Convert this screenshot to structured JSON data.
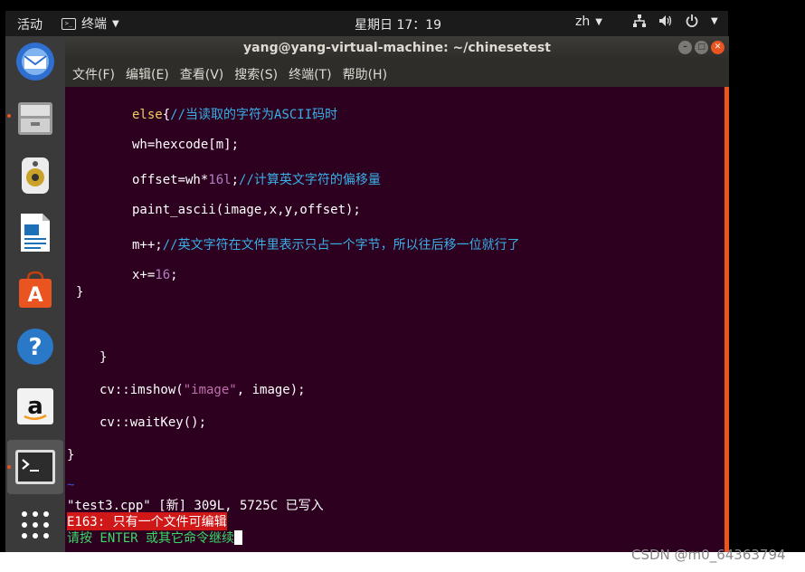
{
  "topbar": {
    "activities": "活动",
    "app_menu": "终端",
    "clock": "星期日 17：19",
    "input_method": "zh"
  },
  "window": {
    "title": "yang@yang-virtual-machine: ~/chinesetest",
    "menus": [
      "文件(F)",
      "编辑(E)",
      "查看(V)",
      "搜索(S)",
      "终端(T)",
      "帮助(H)"
    ]
  },
  "dock": {
    "icons": [
      "thunderbird-icon",
      "files-icon",
      "rhythmbox-icon",
      "writer-icon",
      "software-icon",
      "help-icon",
      "amazon-icon",
      "terminal-icon",
      "show-apps-icon"
    ]
  },
  "code": {
    "l1_kw": "else",
    "l1_brace": "{",
    "l1_comment": "//当读取的字符为ASCII码时",
    "l2": "wh=hexcode[m];",
    "l3_a": "offset=wh*",
    "l3_num": "16l",
    "l3_b": ";",
    "l3_comment": "//计算英文字符的偏移量",
    "l4": "paint_ascii(image,x,y,offset);",
    "l5_a": "m++;",
    "l5_comment": "//英文字符在文件里表示只占一个字节，所以往后移一位就行了",
    "l6_a": "x+=",
    "l6_num": "16",
    "l6_b": ";",
    "l7": "}",
    "l8": "}",
    "l9_a": "cv::imshow(",
    "l9_str": "\"image\"",
    "l9_b": ", image);",
    "l10": "cv::waitKey();",
    "l11": "}",
    "tilde": "~"
  },
  "status": {
    "written": "\"test3.cpp\" [新] 309L, 5725C 已写入",
    "error": "E163: 只有一个文件可编辑",
    "prompt": "请按 ENTER 或其它命令继续"
  },
  "watermark": "CSDN @m0_64363794"
}
